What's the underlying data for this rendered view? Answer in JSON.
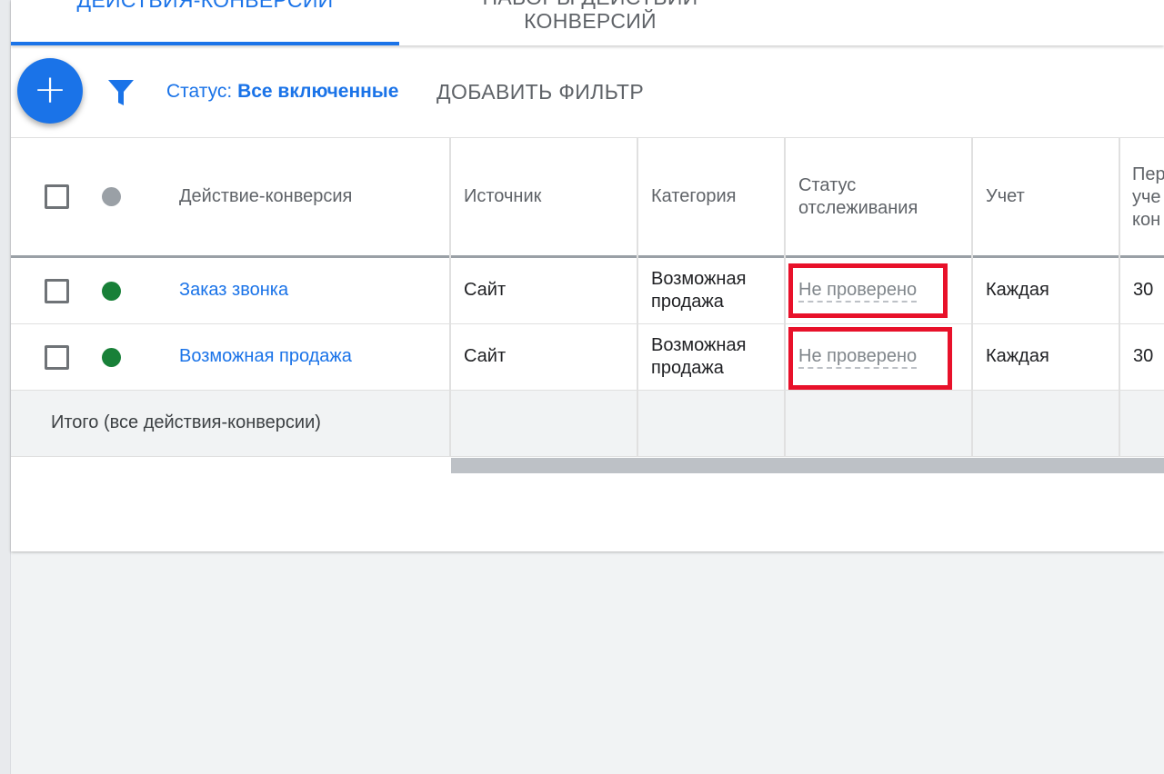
{
  "tabs": {
    "active": "ДЕЙСТВИЯ-КОНВЕРСИИ",
    "second_line1": "НАБОРЫ ДЕЙСТВИЙ",
    "second_line2": "КОНВЕРСИЙ"
  },
  "toolbar": {
    "add_symbol": "+",
    "status_label": "Статус:",
    "status_value": "Все включенные",
    "add_filter": "ДОБАВИТЬ ФИЛЬТР"
  },
  "table": {
    "headers": {
      "action": "Действие-конверсия",
      "source": "Источник",
      "category": "Категория",
      "tracking_status_1": "Статус",
      "tracking_status_2": "отслеживания",
      "count": "Учет",
      "window_1": "Пер",
      "window_2": "уче",
      "window_3": "кон"
    },
    "rows": [
      {
        "name": "Заказ звонка",
        "source": "Сайт",
        "category_1": "Возможная",
        "category_2": "продажа",
        "tracking_status": "Не проверено",
        "count": "Каждая",
        "window": "30"
      },
      {
        "name": "Возможная продажа",
        "source": "Сайт",
        "category_1": "Возможная",
        "category_2": "продажа",
        "tracking_status": "Не проверено",
        "count": "Каждая",
        "window": "30"
      }
    ],
    "totals_label": "Итого (все действия-конверсии)"
  },
  "colors": {
    "accent": "#1a73e8",
    "enabled_dot": "#188038",
    "header_dot": "#9aa0a6",
    "highlight": "#e8112a"
  }
}
